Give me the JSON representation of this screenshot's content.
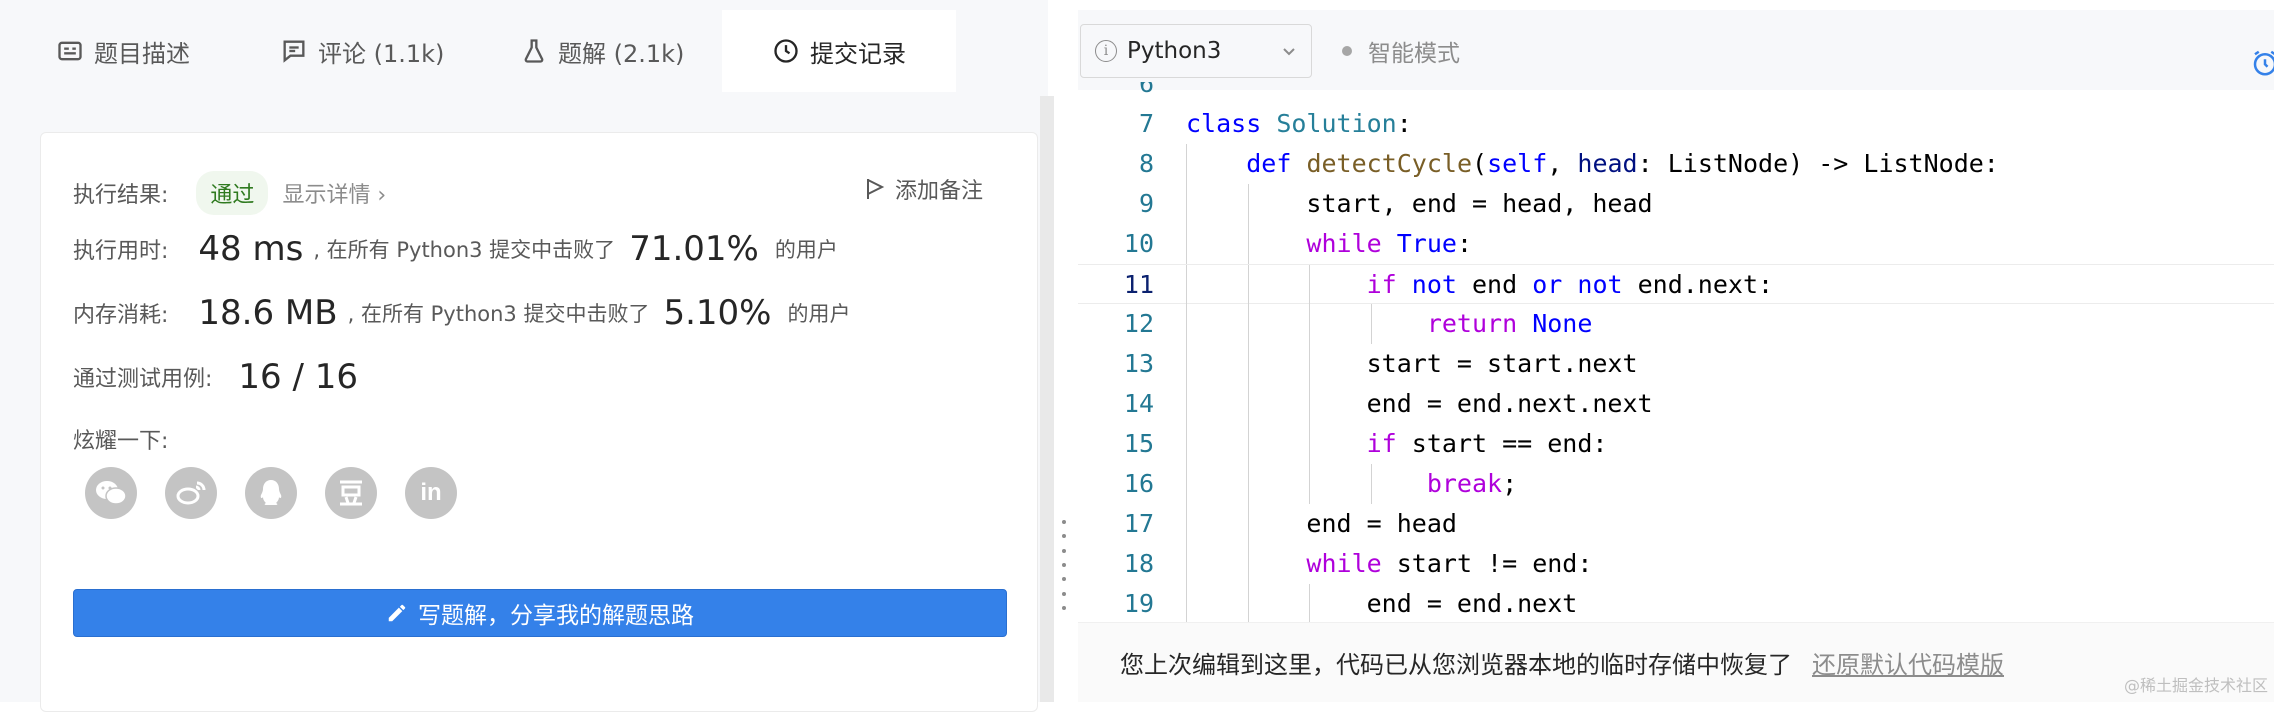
{
  "tabs": [
    {
      "label": "题目描述",
      "icon": "description-icon"
    },
    {
      "label": "评论 (1.1k)",
      "icon": "comment-icon"
    },
    {
      "label": "题解 (2.1k)",
      "icon": "flask-icon"
    },
    {
      "label": "提交记录",
      "icon": "clock-icon"
    }
  ],
  "result": {
    "label": "执行结果:",
    "status": "通过",
    "details_link": "显示详情 ›",
    "add_note": "添加备注"
  },
  "runtime": {
    "label": "执行用时:",
    "value": "48 ms",
    "middle": ", 在所有 Python3 提交中击败了",
    "percent": "71.01%",
    "tail": "的用户"
  },
  "memory": {
    "label": "内存消耗:",
    "value": "18.6 MB",
    "middle": ", 在所有 Python3 提交中击败了",
    "percent": "5.10%",
    "tail": "的用户"
  },
  "testcases": {
    "label": "通过测试用例:",
    "value": "16 / 16"
  },
  "share": {
    "label": "炫耀一下:",
    "icons": [
      "wechat-icon",
      "weibo-icon",
      "qq-icon",
      "douban-icon",
      "linkedin-icon"
    ],
    "button": "写题解，分享我的解题思路"
  },
  "editor": {
    "language": "Python3",
    "smart_mode": "智能模式",
    "current_line": 11
  },
  "code_lines": [
    {
      "n": "6",
      "text": ""
    },
    {
      "n": "7",
      "text": "class Solution:"
    },
    {
      "n": "8",
      "text": "    def detectCycle(self, head: ListNode) -> ListNode:"
    },
    {
      "n": "9",
      "text": "        start, end = head, head"
    },
    {
      "n": "10",
      "text": "        while True:"
    },
    {
      "n": "11",
      "text": "            if not end or not end.next:"
    },
    {
      "n": "12",
      "text": "                return None"
    },
    {
      "n": "13",
      "text": "            start = start.next"
    },
    {
      "n": "14",
      "text": "            end = end.next.next"
    },
    {
      "n": "15",
      "text": "            if start == end:"
    },
    {
      "n": "16",
      "text": "                break;"
    },
    {
      "n": "17",
      "text": "        end = head"
    },
    {
      "n": "18",
      "text": "        while start != end:"
    },
    {
      "n": "19",
      "text": "            end = end.next"
    }
  ],
  "restore": {
    "message": "您上次编辑到这里，代码已从您浏览器本地的临时存储中恢复了",
    "link": "还原默认代码模版"
  },
  "watermark": "@稀土掘金技术社区",
  "colors": {
    "accent_blue": "#3481e9",
    "pass_green": "#2f7a1f",
    "keyword_blue": "#0000ff",
    "keyword_purple": "#af00db",
    "class_teal": "#267f99",
    "function_brown": "#795e26",
    "line_number": "#237893"
  }
}
